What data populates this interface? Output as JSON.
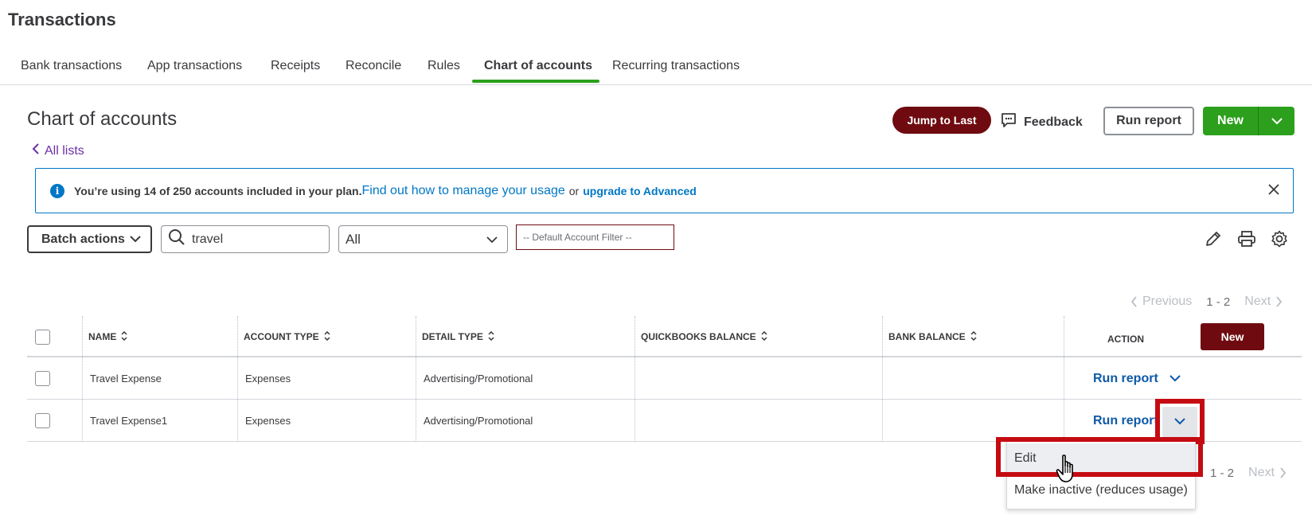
{
  "header": {
    "title": "Transactions"
  },
  "tabs": [
    {
      "label": "Bank transactions"
    },
    {
      "label": "App transactions"
    },
    {
      "label": "Receipts"
    },
    {
      "label": "Reconcile"
    },
    {
      "label": "Rules"
    },
    {
      "label": "Chart of accounts",
      "active": true
    },
    {
      "label": "Recurring transactions"
    }
  ],
  "page": {
    "title": "Chart of accounts",
    "back_link": "All lists",
    "jump_to_last": "Jump to Last",
    "feedback": "Feedback",
    "run_report": "Run report",
    "new": "New"
  },
  "banner": {
    "message": "You’re using 14 of 250 accounts included in your plan.",
    "link": "Find out how to manage your usage",
    "or": "or",
    "upgrade": "upgrade to Advanced"
  },
  "filters": {
    "batch_actions": "Batch actions",
    "search_value": "travel",
    "type_select": "All",
    "account_filter": "-- Default Account Filter --"
  },
  "pagination": {
    "previous": "Previous",
    "range": "1 - 2",
    "next": "Next"
  },
  "table": {
    "columns": [
      "NAME",
      "ACCOUNT TYPE",
      "DETAIL TYPE",
      "QUICKBOOKS BALANCE",
      "BANK BALANCE",
      "ACTION"
    ],
    "new_label": "New",
    "rows": [
      {
        "name": "Travel Expense",
        "account_type": "Expenses",
        "detail_type": "Advertising/Promotional",
        "qb_balance": "",
        "bank_balance": "",
        "action": "Run report"
      },
      {
        "name": "Travel Expense1",
        "account_type": "Expenses",
        "detail_type": "Advertising/Promotional",
        "qb_balance": "",
        "bank_balance": "",
        "action": "Run report"
      }
    ]
  },
  "dropdown": {
    "items": [
      {
        "label": "Edit"
      },
      {
        "label": "Make inactive (reduces usage)"
      }
    ]
  },
  "colors": {
    "accent_green": "#2ca01c",
    "brand_maroon": "#6f0b10",
    "link_blue": "#0077c5",
    "highlight_red": "#c50b12"
  }
}
